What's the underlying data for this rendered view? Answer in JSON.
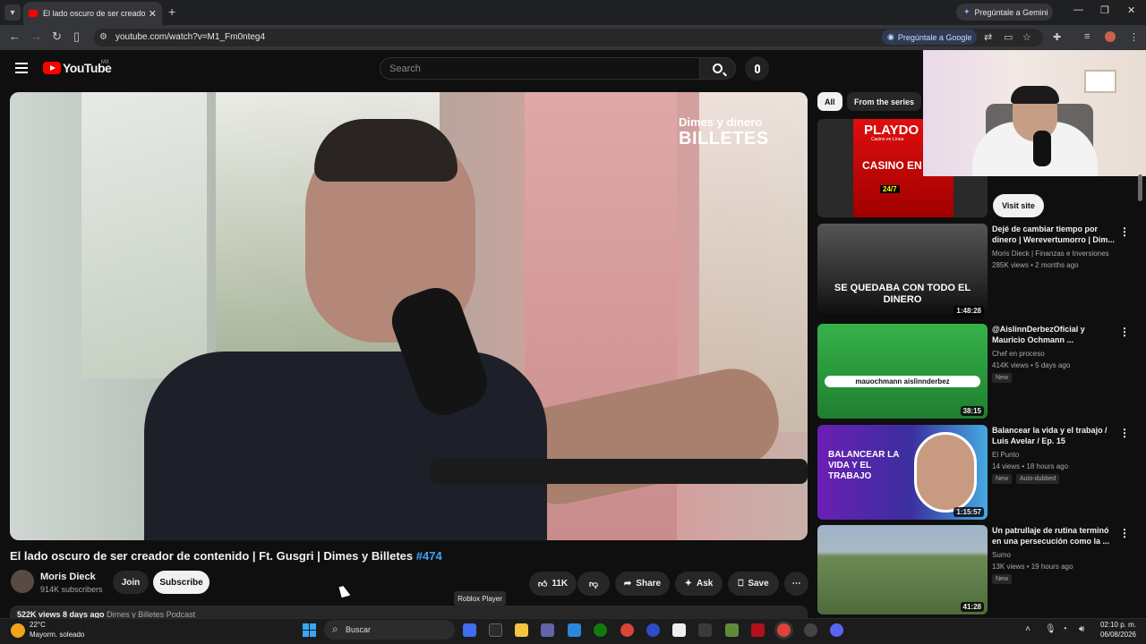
{
  "browser": {
    "tab_title": "El lado oscuro de ser creador de contenido | Ft. Gusgri | Dimes y Billetes #474",
    "gemini_tab": "Pregúntale a Gemini",
    "url": "youtube.com/watch?v=M1_Fm0nteg4",
    "ask_google": "Pregúntale a Google"
  },
  "header": {
    "logo": "YouTube",
    "region": "MX",
    "search_placeholder": "Search"
  },
  "player": {
    "watermark_top": "Dimes y dinero",
    "watermark_bottom": "BILLETES"
  },
  "video": {
    "title": "El lado oscuro de ser creador de contenido | Ft. Gusgri | Dimes y Billetes",
    "hashtag": "#474",
    "channel": "Moris Dieck",
    "subscribers": "914K subscribers",
    "join": "Join",
    "subscribe": "Subscribe",
    "likes": "11K",
    "share": "Share",
    "ask": "Ask",
    "save": "Save",
    "views_line": "522K views  8 days ago",
    "podcast": "Dimes y Billetes Podcast",
    "tooltip": "Roblox Player"
  },
  "sidebar": {
    "chips": [
      "All",
      "From the series"
    ],
    "ad": {
      "brand": "PLAYDO",
      "sub": "Casino en Línea",
      "line": "CASINO EN VIVO",
      "badge": "24/7",
      "visit": "Visit site"
    },
    "videos": [
      {
        "title": "Dejé de cambiar tiempo por dinero | Werevertumorro | Dim...",
        "channel": "Moris Dieck | Finanzas e Inversiones",
        "meta": "285K views • 2 months ago",
        "duration": "1:48:28",
        "badge": "",
        "badge2": "",
        "thumb_text": "SE QUEDABA CON TODO EL DINERO",
        "thumb_color": "#1a1a1a"
      },
      {
        "title": "@AislinnDerbezOficial y Mauricio Ochmann ...",
        "channel": "Chef en proceso",
        "meta": "414K views • 5 days ago",
        "duration": "38:15",
        "badge": "New",
        "badge2": "",
        "thumb_text": "mauochmann  aislinnderbez",
        "thumb_color": "#2aa33a"
      },
      {
        "title": "Balancear la vida y el trabajo / Luis Avelar / Ep. 15",
        "channel": "El Punto",
        "meta": "14 views • 18 hours ago",
        "duration": "1:15:57",
        "badge": "New",
        "badge2": "Auto-dubbed",
        "thumb_text": "BALANCEAR LA VIDA Y EL TRABAJO",
        "thumb_color": "#6a1fb3"
      },
      {
        "title": "Un patrullaje de rutina terminó en una persecución como la ...",
        "channel": "Sumo",
        "meta": "13K views • 19 hours ago",
        "duration": "41:28",
        "badge": "New",
        "badge2": "",
        "thumb_text": "",
        "thumb_color": "#6d8a55"
      }
    ]
  },
  "taskbar": {
    "temp": "22°C",
    "weather": "Mayorm. soleado",
    "search": "Buscar",
    "time": "02:10 p. m.",
    "date": "06/08/2026"
  }
}
